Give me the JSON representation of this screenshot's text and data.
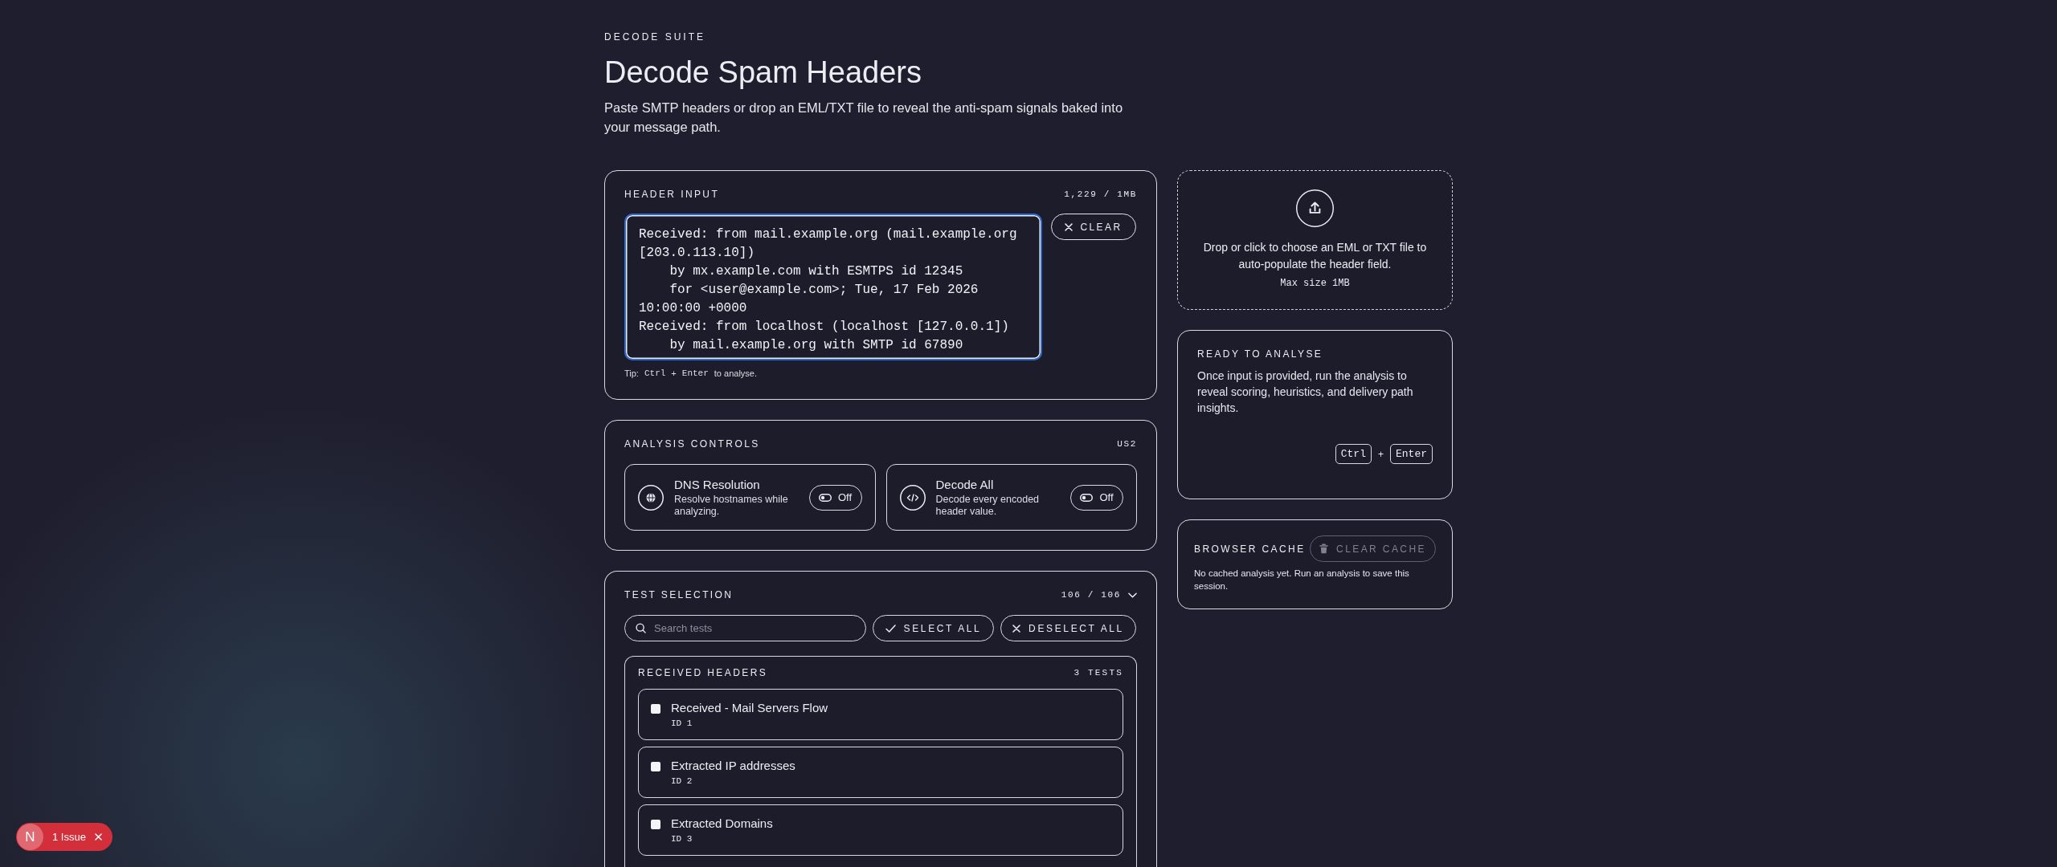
{
  "header": {
    "eyebrow": "DECODE SUITE",
    "title": "Decode Spam Headers",
    "subtitle": "Paste SMTP headers or drop an EML/TXT file to reveal the anti-spam signals baked into your message path."
  },
  "header_input": {
    "label": "HEADER INPUT",
    "size": "1,229 / 1MB",
    "value": "Received: from mail.example.org (mail.example.org [203.0.113.10])\n    by mx.example.com with ESMTPS id 12345\n    for <user@example.com>; Tue, 17 Feb 2026 10:00:00 +0000\nReceived: from localhost (localhost [127.0.0.1])\n    by mail.example.org with SMTP id 67890",
    "focused": true,
    "clear_button": "CLEAR",
    "tip": {
      "prefix": "Tip:",
      "keys": [
        "Ctrl",
        "Enter"
      ],
      "joiner": "+",
      "suffix": "to analyse."
    }
  },
  "analysis_controls": {
    "label": "ANALYSIS CONTROLS",
    "badge": "US2",
    "toggles": [
      {
        "title": "DNS Resolution",
        "description": "Resolve hostnames while analyzing.",
        "on": false,
        "state": "Off"
      },
      {
        "title": "Decode All",
        "description": "Decode every encoded header value.",
        "on": false,
        "state": "Off"
      }
    ]
  },
  "test_selection": {
    "label": "TEST SELECTION",
    "count": "106 / 106",
    "search": {
      "placeholder": "Search tests"
    },
    "select_all": "SELECT ALL",
    "deselect_all": "DESELECT ALL",
    "groups": [
      {
        "title": "RECEIVED HEADERS",
        "count": "3 TESTS",
        "tests": [
          {
            "name": "Received - Mail Servers Flow",
            "id": "ID 1",
            "checked": true
          },
          {
            "name": "Extracted IP addresses",
            "id": "ID 2",
            "checked": true
          },
          {
            "name": "Extracted Domains",
            "id": "ID 3",
            "checked": true
          }
        ]
      }
    ]
  },
  "dropzone": {
    "text": "Drop or click to choose an EML or TXT file to auto-populate the header field.",
    "note": "Max size 1MB"
  },
  "ready": {
    "title": "READY TO ANALYSE",
    "text": "Once input is provided, run the analysis to reveal scoring, heuristics, and delivery path insights.",
    "keys": [
      "Ctrl",
      "Enter"
    ],
    "joiner": "+"
  },
  "browser_cache": {
    "title": "BROWSER CACHE",
    "button": {
      "label": "CLEAR CACHE",
      "disabled": true
    },
    "text": "No cached analysis yet. Run an analysis to save this session."
  },
  "dev_indicator": {
    "logo": "N",
    "label": "1 Issue"
  }
}
